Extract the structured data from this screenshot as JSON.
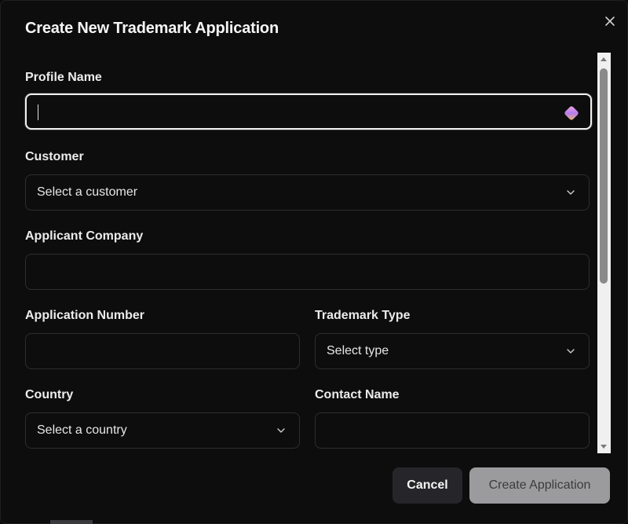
{
  "dialog": {
    "title": "Create New Trademark Application",
    "close_icon": "close-icon"
  },
  "form": {
    "profile_name": {
      "label": "Profile Name",
      "value": "",
      "icon": "gem-icon"
    },
    "customer": {
      "label": "Customer",
      "value": "Select a customer"
    },
    "applicant_company": {
      "label": "Applicant Company",
      "value": ""
    },
    "application_number": {
      "label": "Application Number",
      "value": ""
    },
    "trademark_type": {
      "label": "Trademark Type",
      "value": "Select type"
    },
    "country": {
      "label": "Country",
      "value": "Select a country"
    },
    "contact_name": {
      "label": "Contact Name",
      "value": ""
    }
  },
  "actions": {
    "cancel_label": "Cancel",
    "create_label": "Create Application"
  },
  "colors": {
    "background": "#0d0d0e",
    "input_border": "#2e2e32",
    "focus_border": "#f0f0f0",
    "cancel_bg": "#26262a",
    "create_bg_disabled": "#9b9b9e"
  }
}
